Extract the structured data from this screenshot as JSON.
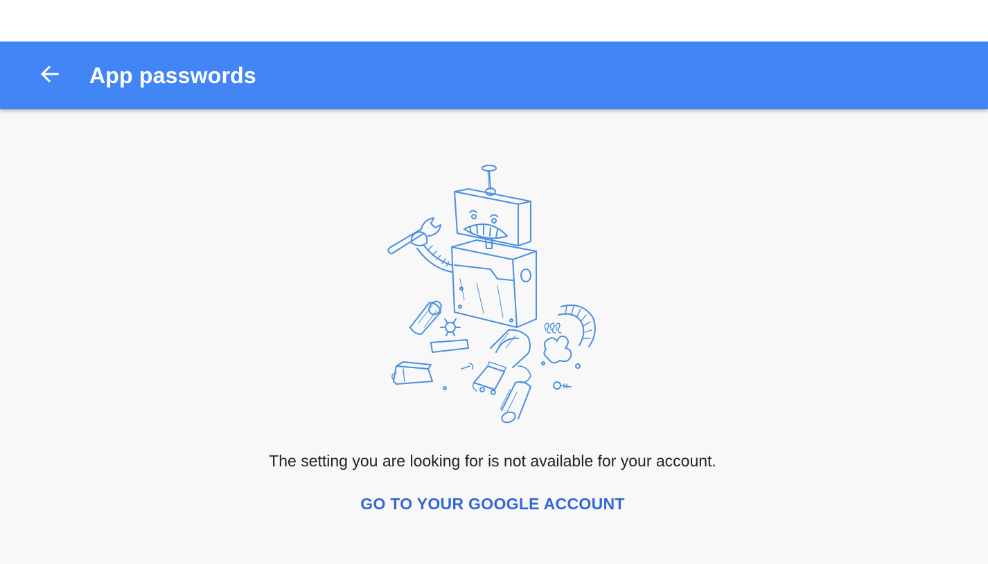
{
  "app_bar": {
    "title": "App passwords",
    "back_icon": "arrow-back-icon",
    "color": "#4285f4"
  },
  "main": {
    "illustration": "broken-robot-illustration",
    "message": "The setting you are looking for is not available for your account.",
    "link_label": "GO TO YOUR GOOGLE ACCOUNT",
    "link_color": "#3367d6",
    "sketch_color": "#4a8fe0"
  }
}
